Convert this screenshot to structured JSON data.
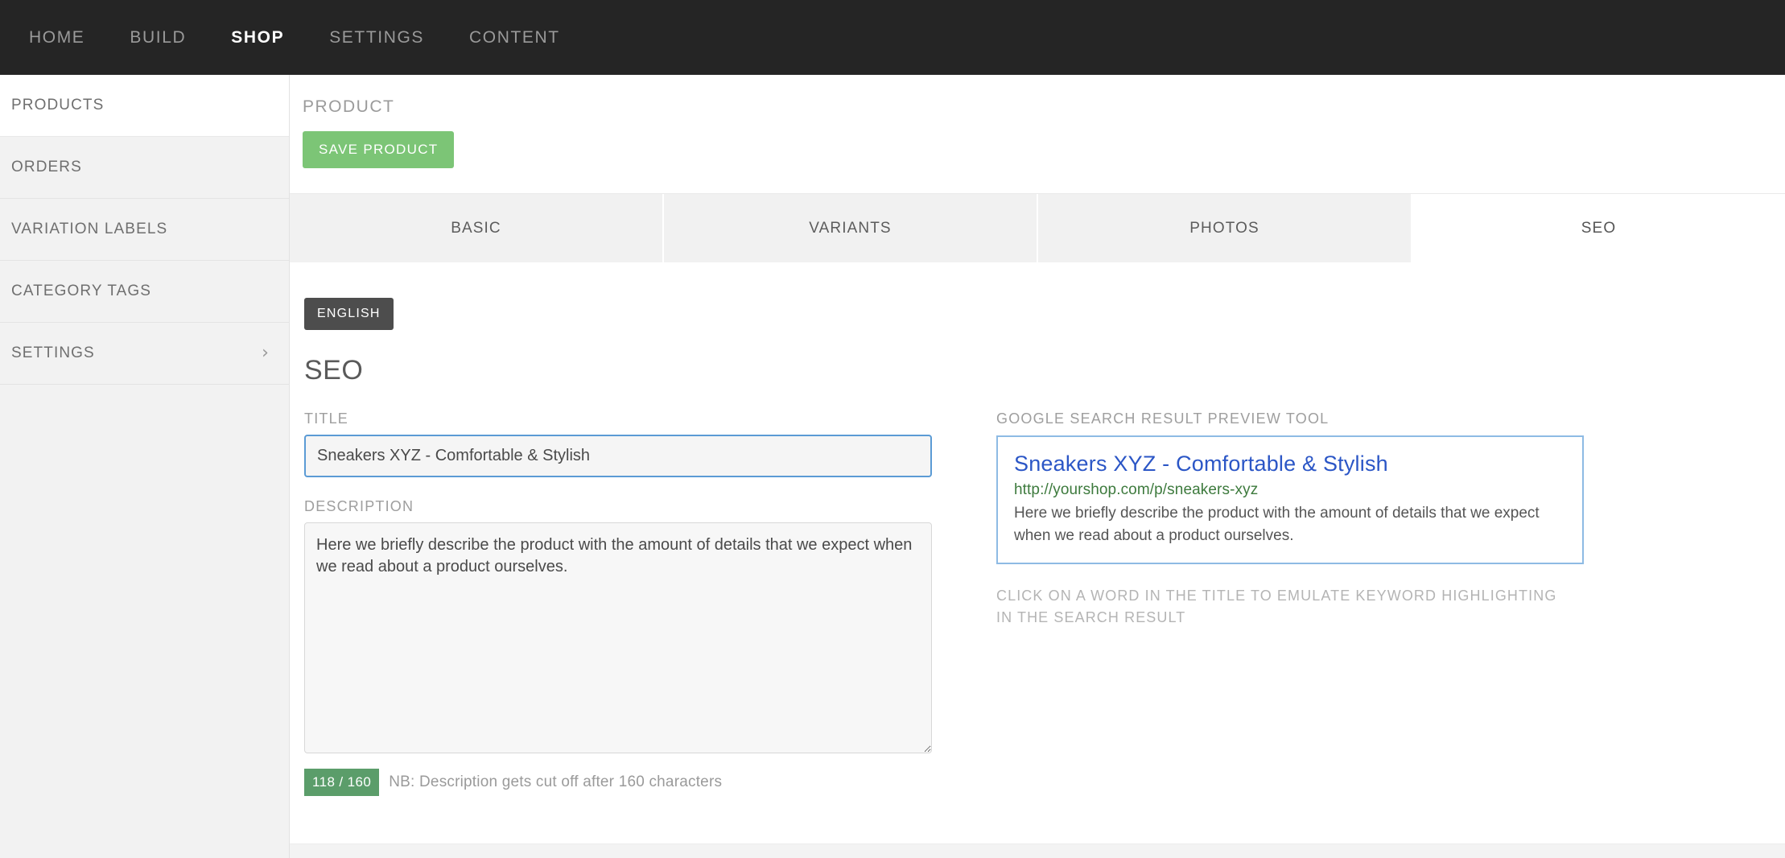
{
  "topnav": {
    "items": [
      {
        "label": "HOME",
        "active": false
      },
      {
        "label": "BUILD",
        "active": false
      },
      {
        "label": "SHOP",
        "active": true
      },
      {
        "label": "SETTINGS",
        "active": false
      },
      {
        "label": "CONTENT",
        "active": false
      }
    ]
  },
  "sidebar": {
    "items": [
      {
        "label": "PRODUCTS",
        "active": true,
        "chevron": ""
      },
      {
        "label": "ORDERS",
        "active": false,
        "chevron": ""
      },
      {
        "label": "VARIATION LABELS",
        "active": false,
        "chevron": ""
      },
      {
        "label": "CATEGORY TAGS",
        "active": false,
        "chevron": ""
      },
      {
        "label": "SETTINGS",
        "active": false,
        "chevron": "›"
      }
    ]
  },
  "header": {
    "page_title": "PRODUCT",
    "save_label": "SAVE PRODUCT"
  },
  "tabs": [
    {
      "label": "BASIC",
      "active": false
    },
    {
      "label": "VARIANTS",
      "active": false
    },
    {
      "label": "PHOTOS",
      "active": false
    },
    {
      "label": "SEO",
      "active": true
    }
  ],
  "seo": {
    "language_button": "ENGLISH",
    "section_title": "SEO",
    "title_label": "TITLE",
    "title_value": "Sneakers XYZ - Comfortable & Stylish",
    "title_placeholder": "",
    "description_label": "DESCRIPTION",
    "description_value": "Here we briefly describe the product with the amount of details that we expect when we read about a product ourselves.",
    "description_placeholder": "",
    "counter_badge": "118 / 160",
    "counter_note": "NB: Description gets cut off after 160 characters"
  },
  "preview": {
    "label": "GOOGLE SEARCH RESULT PREVIEW TOOL",
    "title": "Sneakers XYZ - Comfortable & Stylish",
    "url": "http://yourshop.com/p/sneakers-xyz",
    "description": "Here we briefly describe the product with the amount of details that we expect when we read about a product ourselves.",
    "hint": "CLICK ON A WORD IN THE TITLE TO EMULATE KEYWORD HIGHLIGHTING IN THE SEARCH RESULT"
  },
  "colors": {
    "topnav_bg": "#252525",
    "accent_green": "#7cc576",
    "badge_green": "#5b9d6a",
    "focus_blue": "#5b9bd5",
    "link_blue": "#2b56c6",
    "url_green": "#3d7a3d",
    "lang_dark": "#4d4d4d"
  }
}
